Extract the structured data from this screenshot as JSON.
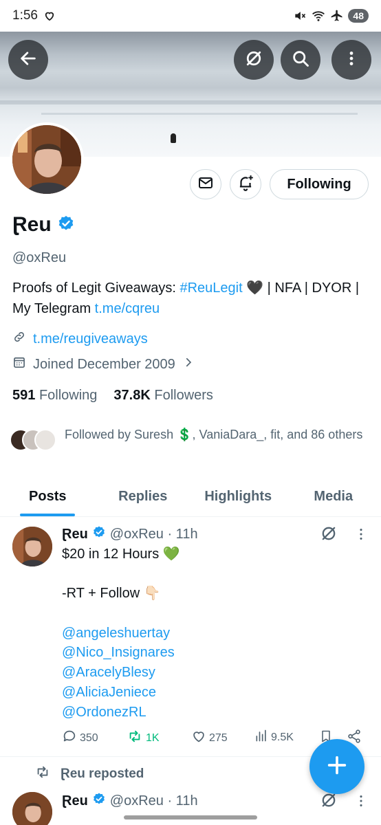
{
  "status_bar": {
    "time": "1:56",
    "battery": "48"
  },
  "profile": {
    "name": "Ɽeu",
    "handle": "@oxReu",
    "bio_text1": "Proofs of Legit Giveaways: ",
    "bio_hashtag": "#ReuLegit",
    "bio_emoji": "🖤",
    "bio_text2": " | NFA | DYOR | My Telegram ",
    "bio_link": "t.me/cqreu",
    "website": "t.me/reugiveaways",
    "joined": "Joined December 2009",
    "following_count": "591",
    "following_label": "Following",
    "followers_count": "37.8K",
    "followers_label": "Followers",
    "followed_by_prefix": "Followed by Suresh ",
    "followed_by_emoji": "💲",
    "followed_by_suffix": ", VaniaDara_, fit, and 86 others",
    "following_button": "Following"
  },
  "tabs": [
    {
      "label": "Posts"
    },
    {
      "label": "Replies"
    },
    {
      "label": "Highlights"
    },
    {
      "label": "Media"
    }
  ],
  "post": {
    "name": "Ɽeu",
    "handle_time": "@oxReu · 11h",
    "line1": "$20 in 12 Hours ",
    "line1_emoji": "💚",
    "line2": "-RT + Follow ",
    "line2_emoji": "👇🏻",
    "mentions": [
      "@angeleshuertay",
      "@Nico_Insignares",
      "@AracelyBlesy",
      "@AliciaJeniece",
      "@OrdonezRL"
    ],
    "replies": "350",
    "reposts": "1K",
    "likes": "275",
    "views": "9.5K"
  },
  "repost_label": "Ɽeu reposted",
  "post2": {
    "name": "Ɽeu",
    "handle_time": "@oxReu · 11h"
  },
  "colors": {
    "accent": "#1d9bf0",
    "repost_green": "#00ba7c",
    "text_secondary": "#536471"
  }
}
